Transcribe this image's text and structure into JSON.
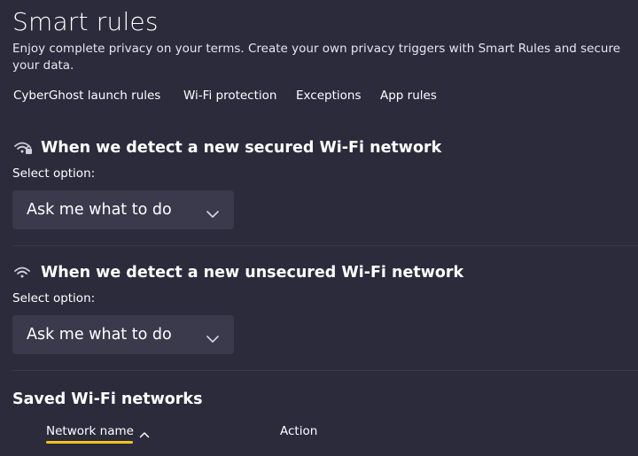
{
  "page": {
    "title": "Smart rules",
    "description": "Enjoy complete privacy on your terms. Create your own privacy triggers with Smart Rules and secure your data."
  },
  "tabs": [
    {
      "label": "CyberGhost launch rules"
    },
    {
      "label": "Wi-Fi protection"
    },
    {
      "label": "Exceptions"
    },
    {
      "label": "App rules"
    }
  ],
  "secured": {
    "title": "When we detect a new secured Wi-Fi network",
    "icon": "secured-wifi-icon",
    "select_label": "Select option:",
    "selected_value": "Ask me what to do"
  },
  "unsecured": {
    "title": "When we detect a new unsecured Wi-Fi network",
    "icon": "wifi-icon",
    "select_label": "Select option:",
    "selected_value": "Ask me what to do"
  },
  "saved_networks": {
    "title": "Saved Wi-Fi networks",
    "columns": [
      {
        "label": "Network name",
        "sort": "ascending"
      },
      {
        "label": "Action"
      }
    ]
  },
  "colors": {
    "background": "#2c2b3c",
    "dropdown_bg": "#3b3a4c",
    "accent": "#f2c21c",
    "text": "#ffffff"
  }
}
